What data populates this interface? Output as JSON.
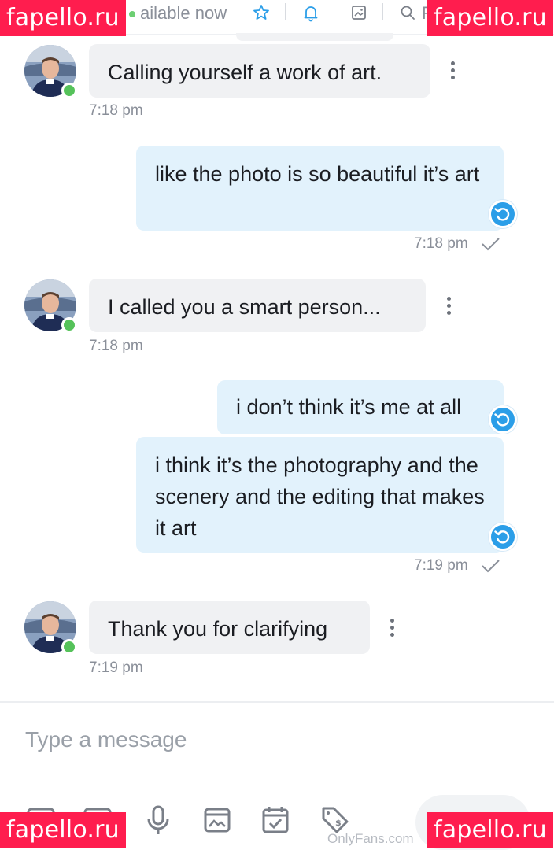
{
  "topbar": {
    "status_text": "ailable now",
    "icons": [
      "star-icon",
      "bell-icon",
      "image-icon",
      "search-icon"
    ],
    "search_partial": "F"
  },
  "watermark": {
    "text": "fapello.ru",
    "color": "#ff1d4e"
  },
  "messages": [
    {
      "direction": "in",
      "text": "Calling yourself a work of art.",
      "time": "7:18 pm"
    },
    {
      "direction": "out",
      "text": "like the photo is so beautiful it’s art",
      "time": "7:18 pm"
    },
    {
      "direction": "in",
      "text": "I called you a smart person...",
      "time": "7:18 pm"
    },
    {
      "direction": "out",
      "text": "i don’t think it’s me at all"
    },
    {
      "direction": "out",
      "text": "i think it’s the photography and the scenery and the editing that makes it art",
      "time": "7:19 pm"
    },
    {
      "direction": "in",
      "text": "Thank you for clarifying",
      "time": "7:19 pm"
    }
  ],
  "composer": {
    "placeholder": "Type a message",
    "tools": [
      "media-icon",
      "gif-icon",
      "microphone-icon",
      "image-icon",
      "calendar-icon",
      "price-tag-icon"
    ]
  },
  "footer": {
    "brand": "OnlyFans.com"
  },
  "colors": {
    "accent": "#2b9ee8",
    "bubble_out": "#e2f2fc",
    "bubble_in": "#f0f1f3",
    "online": "#55c25a"
  }
}
